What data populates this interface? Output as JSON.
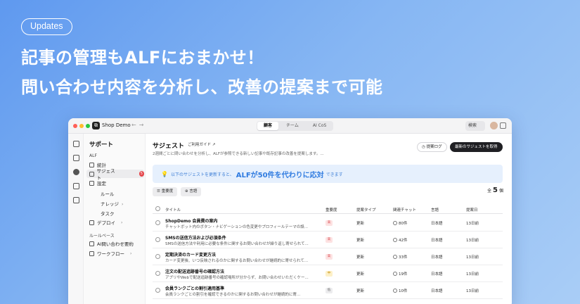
{
  "badge": "Updates",
  "headline_1": "記事の管理もALFにおまかせ！",
  "headline_2": "問い合わせ内容を分析し、改善の提案まで可能",
  "window": {
    "app_name": "Shop Demo",
    "tabs": [
      "顧客",
      "チーム",
      "AI CoS"
    ],
    "search_label": "検索"
  },
  "sidebar": {
    "title": "サポート",
    "section_alf": "ALF",
    "items": [
      "統計",
      "サジェスト",
      "設定"
    ],
    "suggest_count": "5",
    "sub_items": [
      "ルール",
      "ナレッジ",
      "タスク"
    ],
    "deploy": "デプロイ",
    "section_rules": "ルールベース",
    "rule_items": [
      "AI問い合わせ要約",
      "ワークフロー"
    ]
  },
  "main": {
    "title": "サジェスト",
    "guide_link": "ご利用ガイド ↗",
    "description": "2週間ごとに問い合わせを分析し、ALFが参照できる新しい記事や既存記事の改善を提案します。...",
    "log_button": "提案ログ",
    "fetch_button": "最新のサジェストを取得",
    "banner_pre": "以下のサジェストを更新すると、",
    "banner_strong": "ALFが50件を代わりに応対",
    "banner_post": "できます",
    "filters": [
      "重要度",
      "言語"
    ],
    "total_prefix": "全",
    "total_count": "5",
    "total_suffix": "個"
  },
  "table": {
    "headers": [
      "タイトル",
      "重要度",
      "提案タイプ",
      "関連チャット",
      "言語",
      "提案日"
    ],
    "rows": [
      {
        "title": "ShopDemo 会員費の案内",
        "desc": "チャットボット内のボタン・ナビゲーションの色変更やプロフィールテーマの設...",
        "priority": "高",
        "type": "更新",
        "chats": "80件",
        "lang": "日本語",
        "date": "13日前"
      },
      {
        "title": "SMSの送信方法および必須条件",
        "desc": "SMSの送信方法や利用に必要な条件に関するお問い合わせが繰り返し寄せられて...",
        "priority": "高",
        "type": "更新",
        "chats": "42件",
        "lang": "日本語",
        "date": "13日前"
      },
      {
        "title": "定期決済のカード変更方法",
        "desc": "カード変更後、いつ反映されるのかに関するお問い合わせが継続的に寄せられて...",
        "priority": "高",
        "type": "更新",
        "chats": "33件",
        "lang": "日本語",
        "date": "13日前"
      },
      {
        "title": "注文の配送追跡番号の確認方法",
        "desc": "アプリやWebで配送追跡番号の確認場所が分からず、お問い合わせいただくケー...",
        "priority": "中",
        "type": "更新",
        "chats": "19件",
        "lang": "日本語",
        "date": "13日前"
      },
      {
        "title": "会員ランクごとの割引適用基準",
        "desc": "会員ランクごとの割引を確認できるのかに関するお問い合わせが継続的に寄...",
        "priority": "低",
        "type": "更新",
        "chats": "10件",
        "lang": "日本語",
        "date": "13日前"
      }
    ]
  },
  "colors": {
    "priority_high_bg": "#fde2e2",
    "priority_high_fg": "#d9434a",
    "priority_mid_bg": "#fdf0c8",
    "priority_mid_fg": "#c28a00",
    "priority_low_bg": "#ececee",
    "priority_low_fg": "#666666"
  }
}
